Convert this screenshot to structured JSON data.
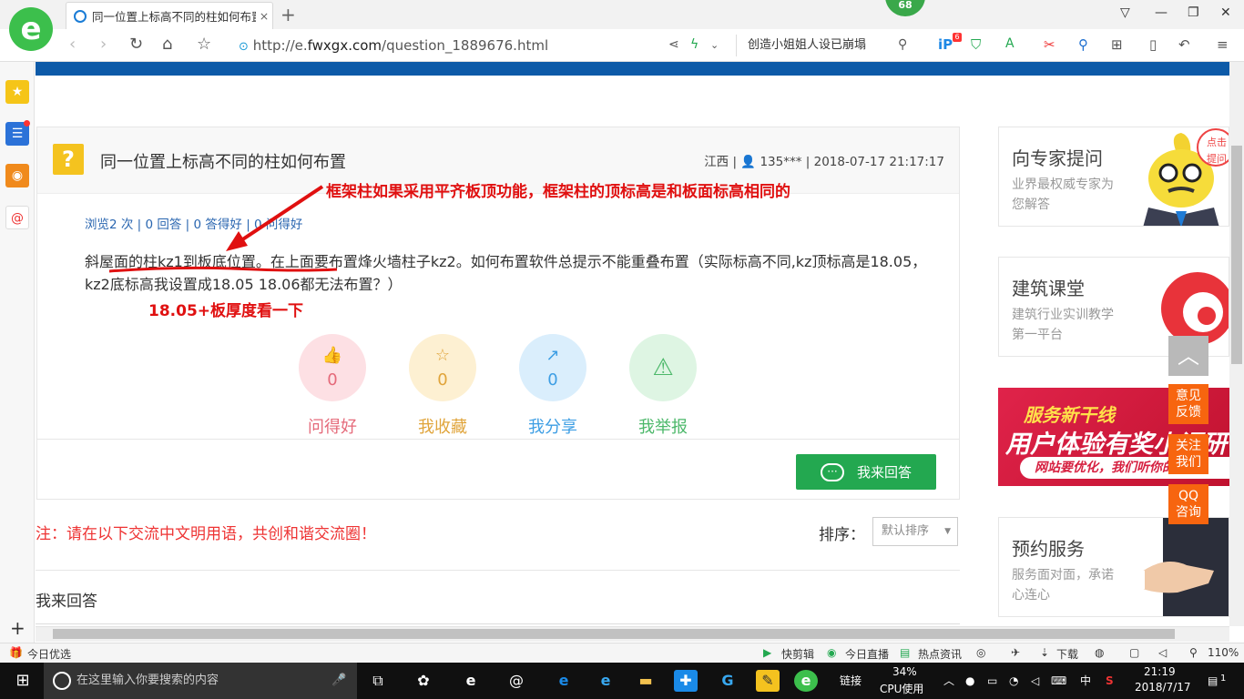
{
  "browser": {
    "tab_title": "同一位置上标高不同的柱如何布置",
    "tab_close": "×",
    "new_tab": "+",
    "badge": "68",
    "url_prefix": "http://e.",
    "url_domain": "fwxgx.com",
    "url_path": "/question_1889676.html",
    "search_query": "创造小姐姐人设已崩塌",
    "ext_badge": "6"
  },
  "question": {
    "title": "同一位置上标高不同的柱如何布置",
    "region": "江西",
    "user": "135***",
    "time": "2018-07-17 21:17:17",
    "stats": "浏览2 次 | 0 回答 | 0 答得好 | 0 问得好",
    "body": "斜屋面的柱kz1到板底位置。在上面要布置烽火墙柱子kz2。如何布置软件总提示不能重叠布置（实际标高不同,kz顶标高是18.05，kz2底标高我设置成18.05 18.06都无法布置？）"
  },
  "actions": [
    {
      "label": "问得好",
      "count": "0"
    },
    {
      "label": "我收藏",
      "count": "0"
    },
    {
      "label": "我分享",
      "count": "0"
    },
    {
      "label": "我举报",
      "count": ""
    }
  ],
  "answer_button": "我来回答",
  "comments": {
    "note": "注：请在以下交流中文明用语，共创和谐交流圈！",
    "sort_label": "排序：",
    "sort_value": "默认排序",
    "my_answer": "我来回答"
  },
  "annotations": {
    "top": "框架柱如果采用平齐板顶功能，框架柱的顶标高是和板面标高相同的",
    "bottom": "18.05+板厚度看一下"
  },
  "sidebar_cards": [
    {
      "title": "向专家提问",
      "desc": "业界最权威专家为您解答",
      "bubble": "点击提问"
    },
    {
      "title": "建筑课堂",
      "desc": "建筑行业实训教学第一平台"
    },
    {
      "title": "预约服务",
      "desc": "服务面对面，承诺心连心"
    }
  ],
  "ad": {
    "line1": "服务新干线",
    "line2": "用户体验有奖小调研",
    "line3": "网站要优化，我们听你的"
  },
  "floating": {
    "feedback": "意见反馈",
    "follow": "关注我们",
    "qq": "QQ咨询"
  },
  "statusbar": {
    "left": "今日优选",
    "items": [
      "快剪辑",
      "今日直播",
      "热点资讯"
    ],
    "download": "下载",
    "zoom": "110%"
  },
  "taskbar": {
    "search_placeholder": "在这里输入你要搜索的内容",
    "link": "链接",
    "cpu_pct": "34%",
    "cpu_label": "CPU使用",
    "ime": "中",
    "time": "21:19",
    "date": "2018/7/17",
    "notif": "1"
  }
}
